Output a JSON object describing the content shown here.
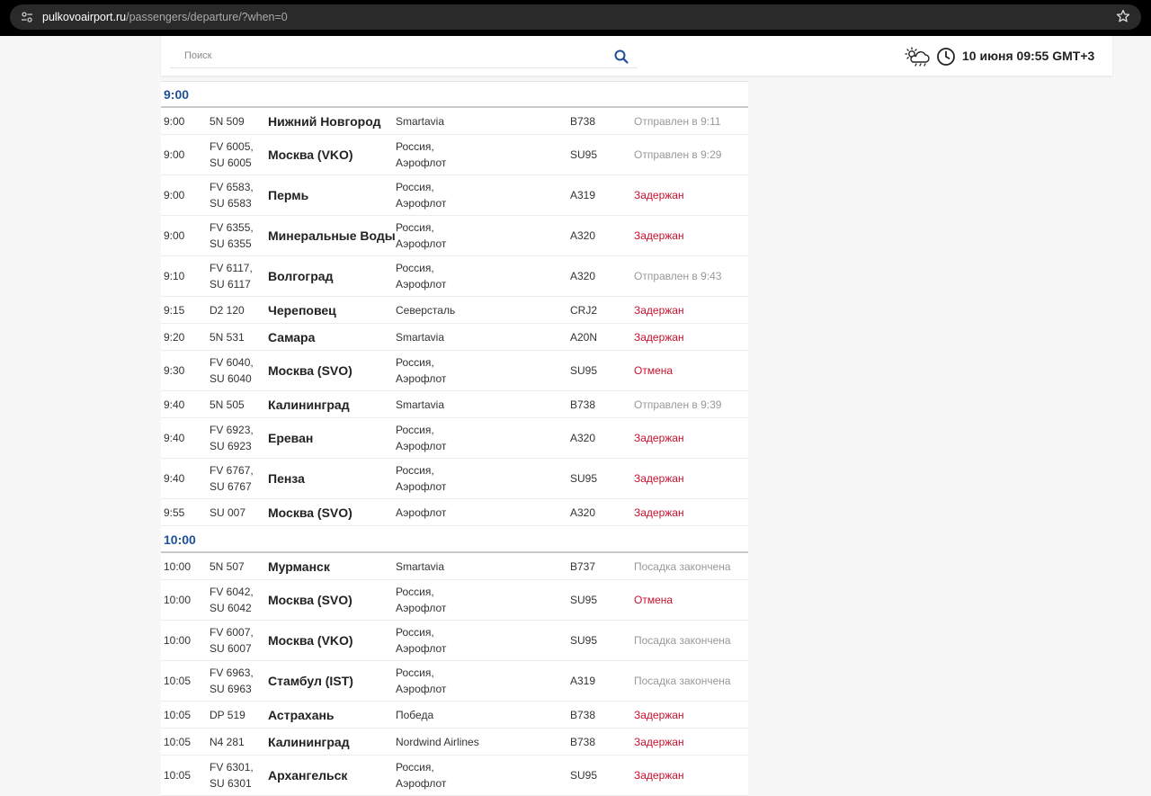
{
  "browser": {
    "url_host": "pulkovoairport.ru",
    "url_path": "/passengers/departure/?when=0"
  },
  "header": {
    "search_placeholder": "Поиск",
    "datetime": "10 июня 09:55 GMT+3"
  },
  "colors": {
    "accent": "#1e4f9c",
    "status_red": "#c8102e",
    "status_gray": "#999999"
  },
  "groups": [
    {
      "title": "9:00",
      "rows": [
        {
          "time": "9:00",
          "flight": "5N 509",
          "city": "Нижний Новгород",
          "airline": "Smartavia",
          "aircraft": "B738",
          "status": "Отправлен в 9:11",
          "status_kind": "gray"
        },
        {
          "time": "9:00",
          "flight": "FV 6005,\nSU 6005",
          "city": "Москва (VKO)",
          "airline": "Россия,\nАэрофлот",
          "aircraft": "SU95",
          "status": "Отправлен в 9:29",
          "status_kind": "gray"
        },
        {
          "time": "9:00",
          "flight": "FV 6583,\nSU 6583",
          "city": "Пермь",
          "airline": "Россия,\nАэрофлот",
          "aircraft": "A319",
          "status": "Задержан",
          "status_kind": "red"
        },
        {
          "time": "9:00",
          "flight": "FV 6355,\nSU 6355",
          "city": "Минеральные Воды",
          "airline": "Россия,\nАэрофлот",
          "aircraft": "A320",
          "status": "Задержан",
          "status_kind": "red"
        },
        {
          "time": "9:10",
          "flight": "FV 6117,\nSU 6117",
          "city": "Волгоград",
          "airline": "Россия,\nАэрофлот",
          "aircraft": "A320",
          "status": "Отправлен в 9:43",
          "status_kind": "gray"
        },
        {
          "time": "9:15",
          "flight": "D2 120",
          "city": "Череповец",
          "airline": "Северсталь",
          "aircraft": "CRJ2",
          "status": "Задержан",
          "status_kind": "red"
        },
        {
          "time": "9:20",
          "flight": "5N 531",
          "city": "Самара",
          "airline": "Smartavia",
          "aircraft": "A20N",
          "status": "Задержан",
          "status_kind": "red"
        },
        {
          "time": "9:30",
          "flight": "FV 6040,\nSU 6040",
          "city": "Москва (SVO)",
          "airline": "Россия,\nАэрофлот",
          "aircraft": "SU95",
          "status": "Отмена",
          "status_kind": "red"
        },
        {
          "time": "9:40",
          "flight": "5N 505",
          "city": "Калининград",
          "airline": "Smartavia",
          "aircraft": "B738",
          "status": "Отправлен в 9:39",
          "status_kind": "gray"
        },
        {
          "time": "9:40",
          "flight": "FV 6923,\nSU 6923",
          "city": "Ереван",
          "airline": "Россия,\nАэрофлот",
          "aircraft": "A320",
          "status": "Задержан",
          "status_kind": "red"
        },
        {
          "time": "9:40",
          "flight": "FV 6767,\nSU 6767",
          "city": "Пенза",
          "airline": "Россия,\nАэрофлот",
          "aircraft": "SU95",
          "status": "Задержан",
          "status_kind": "red"
        },
        {
          "time": "9:55",
          "flight": "SU 007",
          "city": "Москва (SVO)",
          "airline": "Аэрофлот",
          "aircraft": "A320",
          "status": "Задержан",
          "status_kind": "red"
        }
      ]
    },
    {
      "title": "10:00",
      "rows": [
        {
          "time": "10:00",
          "flight": "5N 507",
          "city": "Мурманск",
          "airline": "Smartavia",
          "aircraft": "B737",
          "status": "Посадка закончена",
          "status_kind": "gray"
        },
        {
          "time": "10:00",
          "flight": "FV 6042,\nSU 6042",
          "city": "Москва (SVO)",
          "airline": "Россия,\nАэрофлот",
          "aircraft": "SU95",
          "status": "Отмена",
          "status_kind": "red"
        },
        {
          "time": "10:00",
          "flight": "FV 6007,\nSU 6007",
          "city": "Москва (VKO)",
          "airline": "Россия,\nАэрофлот",
          "aircraft": "SU95",
          "status": "Посадка закончена",
          "status_kind": "gray"
        },
        {
          "time": "10:05",
          "flight": "FV 6963,\nSU 6963",
          "city": "Стамбул (IST)",
          "airline": "Россия,\nАэрофлот",
          "aircraft": "A319",
          "status": "Посадка закончена",
          "status_kind": "gray"
        },
        {
          "time": "10:05",
          "flight": "DP 519",
          "city": "Астрахань",
          "airline": "Победа",
          "aircraft": "B738",
          "status": "Задержан",
          "status_kind": "red"
        },
        {
          "time": "10:05",
          "flight": "N4 281",
          "city": "Калининград",
          "airline": "Nordwind Airlines",
          "aircraft": "B738",
          "status": "Задержан",
          "status_kind": "red"
        },
        {
          "time": "10:05",
          "flight": "FV 6301,\nSU 6301",
          "city": "Архангельск",
          "airline": "Россия,\nАэрофлот",
          "aircraft": "SU95",
          "status": "Задержан",
          "status_kind": "red"
        }
      ]
    }
  ]
}
